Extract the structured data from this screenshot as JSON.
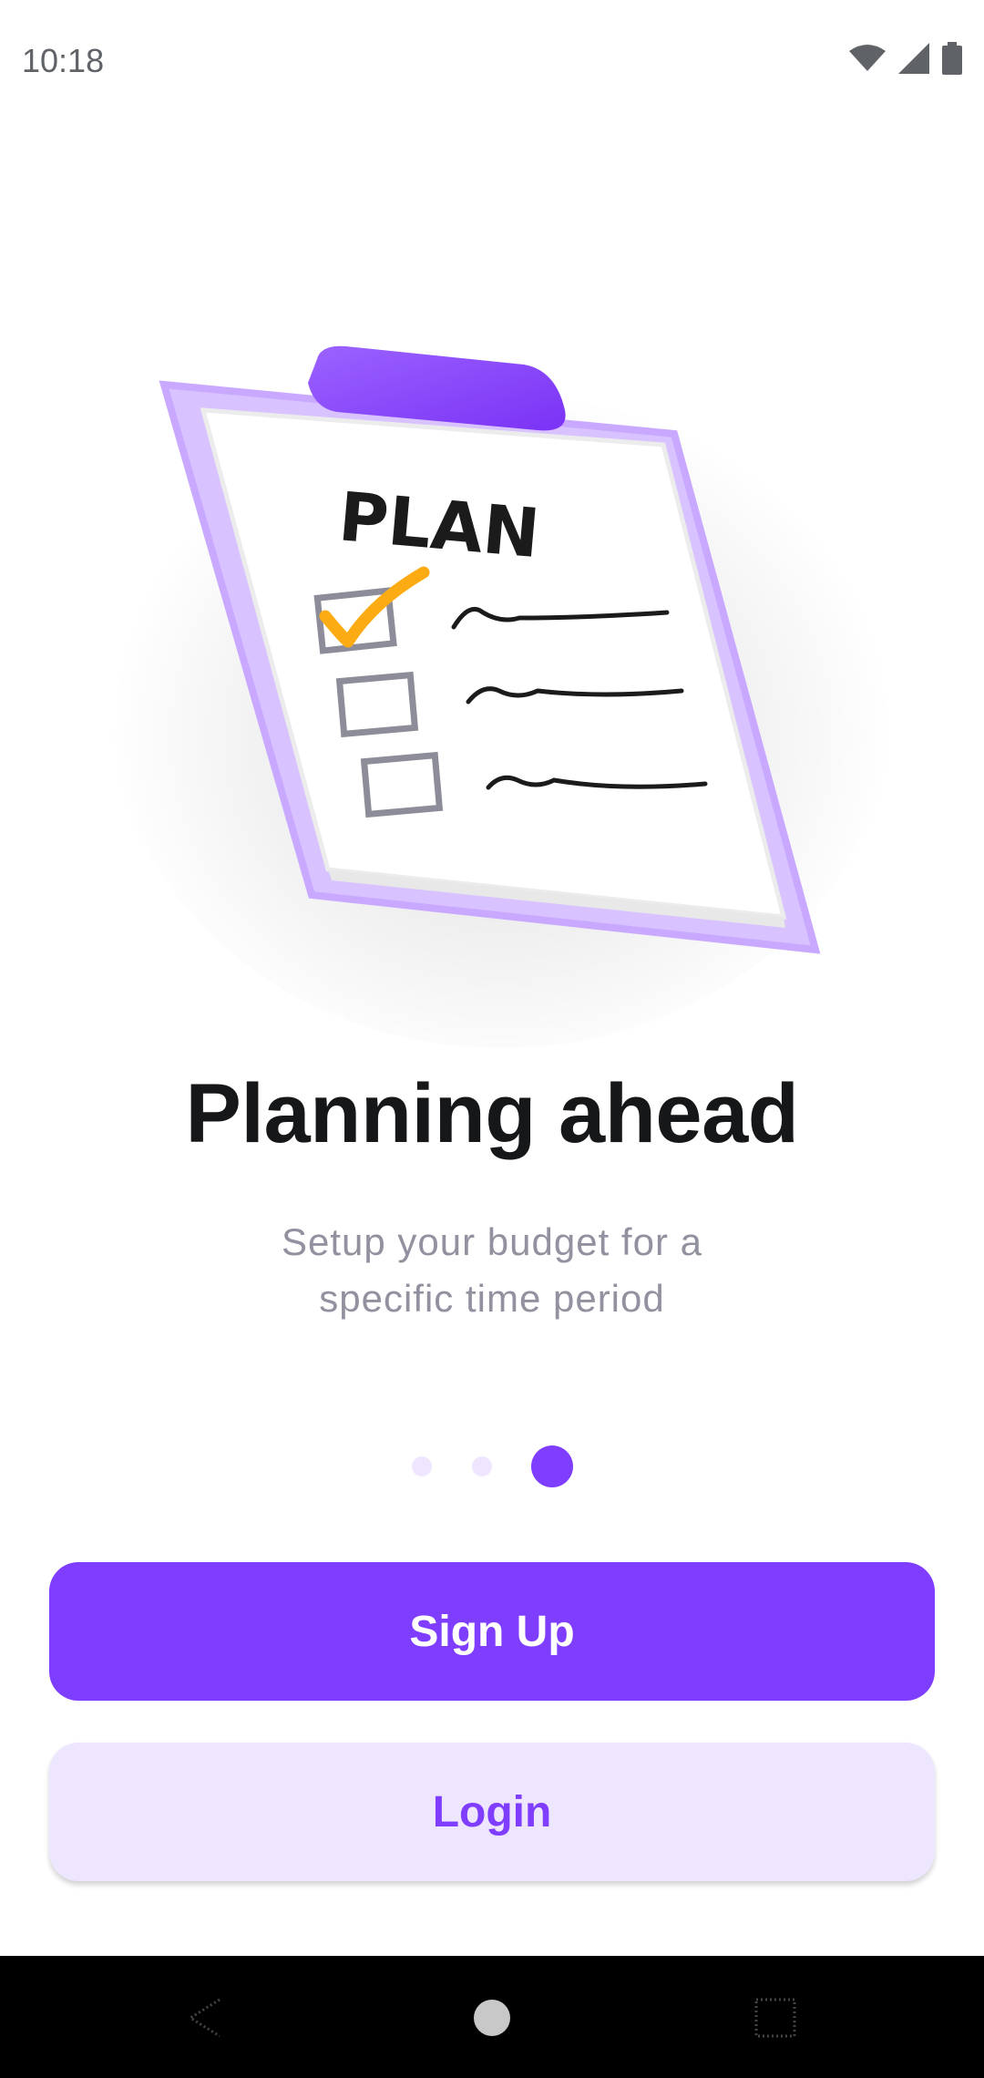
{
  "status_bar": {
    "time": "10:18"
  },
  "illustration": {
    "clipboard_text": "PLAN",
    "checked_items": 1,
    "total_items": 3
  },
  "onboarding": {
    "title": "Planning ahead",
    "subtitle": "Setup your budget for a specific time period",
    "page_count": 3,
    "active_page": 3
  },
  "actions": {
    "signup_label": "Sign Up",
    "login_label": "Login"
  },
  "colors": {
    "accent": "#7f3dff",
    "accent_light": "#eee5ff",
    "check": "#fcac12"
  }
}
